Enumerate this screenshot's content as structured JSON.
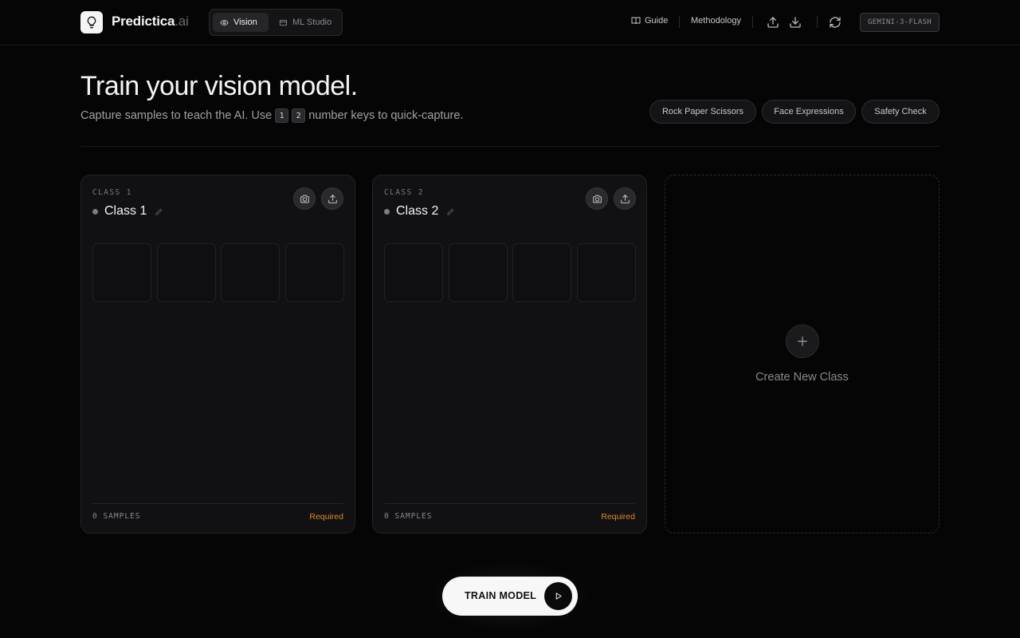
{
  "header": {
    "brand_name": "Predictica",
    "brand_suffix": ".ai",
    "modes": [
      {
        "label": "Vision",
        "icon": "eye-icon",
        "active": true
      },
      {
        "label": "ML Studio",
        "icon": "dataset-icon",
        "active": false
      }
    ],
    "nav": {
      "guide_label": "Guide",
      "methodology_label": "Methodology"
    },
    "actions": [
      "upload-icon",
      "download-icon",
      "refresh-icon"
    ],
    "model_badge": "GEMINI-3-FLASH"
  },
  "hero": {
    "title": "Train your vision model.",
    "subtitle_before": "Capture samples to teach the AI. Use",
    "key_1": "1",
    "key_2": "2",
    "subtitle_after": "number keys to quick-capture.",
    "presets": [
      "Rock Paper Scissors",
      "Face Expressions",
      "Safety Check"
    ]
  },
  "classes": [
    {
      "label": "CLASS 1",
      "name": "Class 1",
      "samples": "0 SAMPLES",
      "status": "Required"
    },
    {
      "label": "CLASS 2",
      "name": "Class 2",
      "samples": "0 SAMPLES",
      "status": "Required"
    }
  ],
  "new_class": {
    "label": "Create New Class"
  },
  "train": {
    "label": "TRAIN MODEL"
  },
  "colors": {
    "background": "#050505",
    "card": "#111113",
    "required": "#d98a2b",
    "train_button": "#f7f7f7"
  }
}
